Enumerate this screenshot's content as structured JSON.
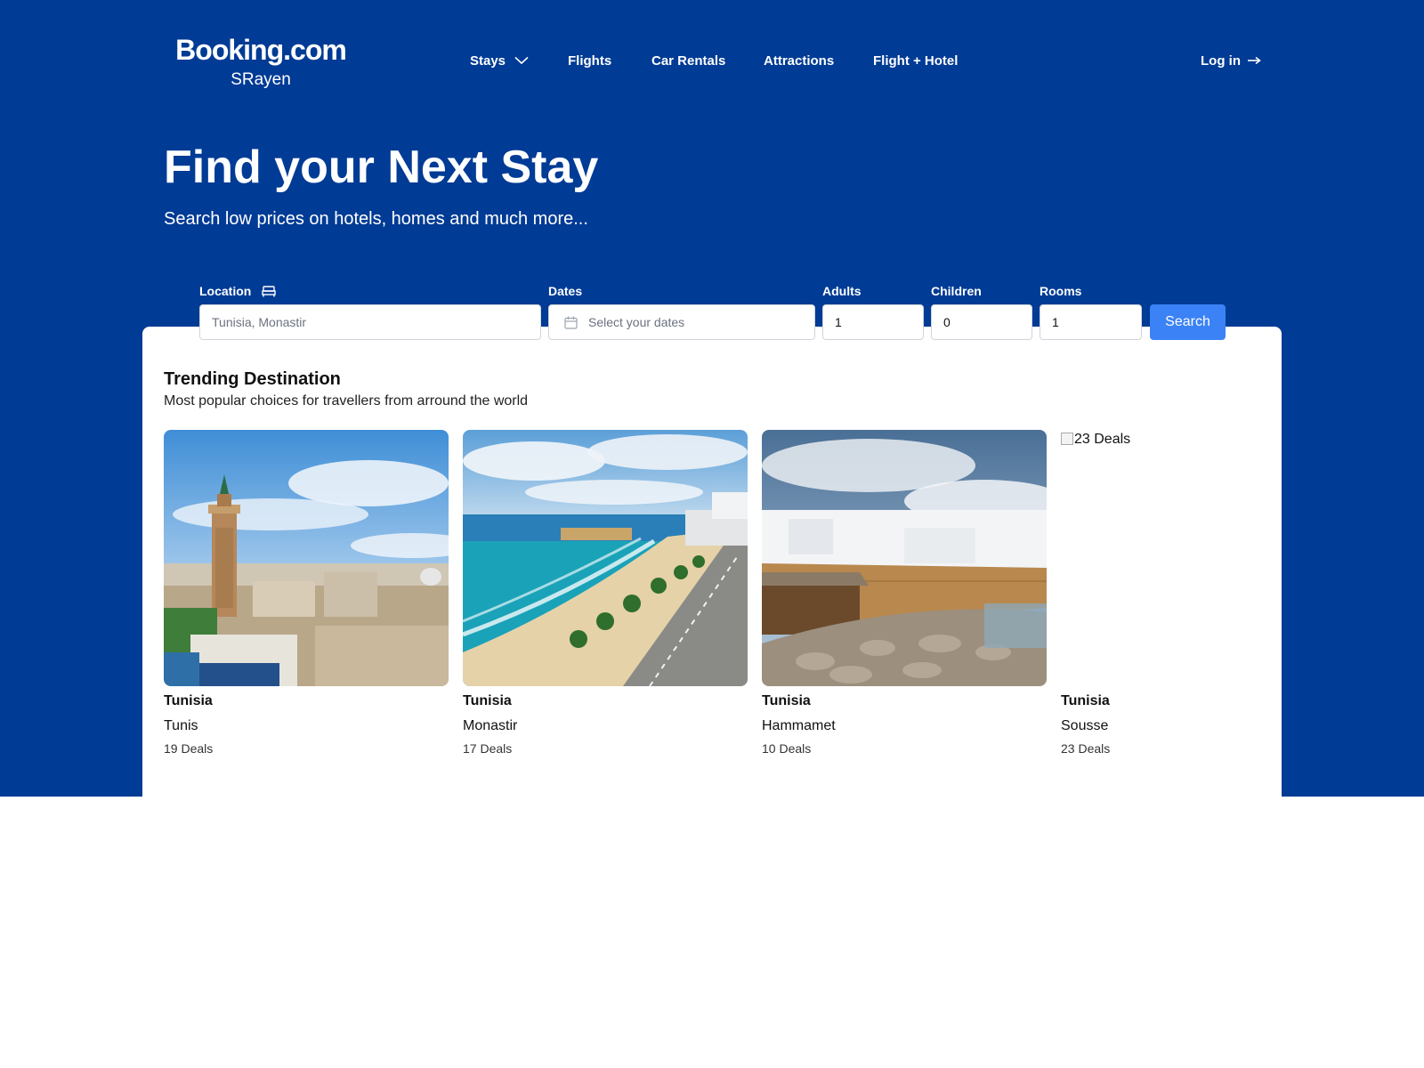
{
  "header": {
    "brand": "Booking.com",
    "brand_sub": "SRayen",
    "nav": [
      {
        "label": "Stays",
        "has_dropdown": true
      },
      {
        "label": "Flights"
      },
      {
        "label": "Car Rentals"
      },
      {
        "label": "Attractions"
      },
      {
        "label": "Flight + Hotel"
      }
    ],
    "login": "Log in",
    "login_icon": "arrow-right-icon"
  },
  "hero": {
    "title": "Find your Next Stay",
    "subtitle": "Search low prices on hotels, homes and much more..."
  },
  "search": {
    "location_label": "Location",
    "location_icon": "bed-icon",
    "location_placeholder": "Tunisia, Monastir",
    "dates_label": "Dates",
    "dates_placeholder": "Select your dates",
    "adults_label": "Adults",
    "adults_value": "1",
    "children_label": "Children",
    "children_value": "0",
    "rooms_label": "Rooms",
    "rooms_value": "1",
    "button": "Search"
  },
  "trending": {
    "title": "Trending Destination",
    "subtitle": "Most popular choices for travellers from arround the world",
    "items": [
      {
        "country": "Tunisia",
        "city": "Tunis",
        "deals": "19 Deals",
        "image": "tunis-medina-minaret"
      },
      {
        "country": "Tunisia",
        "city": "Monastir",
        "deals": "17 Deals",
        "image": "monastir-beach"
      },
      {
        "country": "Tunisia",
        "city": "Hammamet",
        "deals": "10 Deals",
        "image": "hammamet-wall-cafe"
      },
      {
        "country": "Tunisia",
        "city": "Sousse",
        "deals": "23 Deals",
        "image_alt": "23 Deals"
      }
    ]
  },
  "colors": {
    "hero_bg": "#003b95",
    "search_button": "#3b82f6",
    "card_bg": "#ffffff"
  }
}
